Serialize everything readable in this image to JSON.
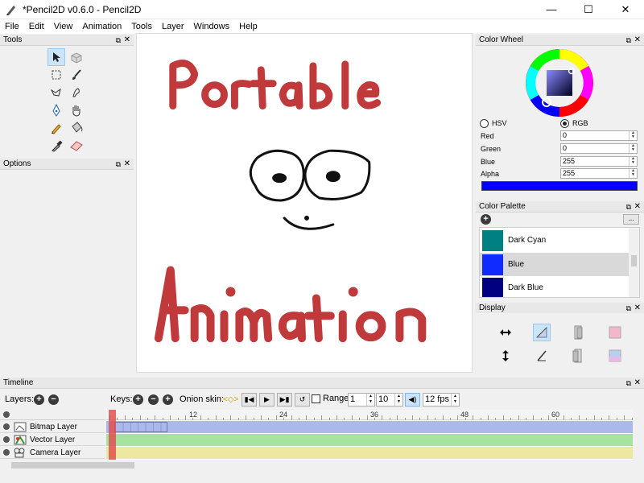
{
  "window": {
    "title": "*Pencil2D v0.6.0 - Pencil2D",
    "minimize": "—",
    "maximize": "☐",
    "close": "✕"
  },
  "menu": [
    "File",
    "Edit",
    "View",
    "Animation",
    "Tools",
    "Layer",
    "Windows",
    "Help"
  ],
  "panels": {
    "tools": "Tools",
    "options": "Options",
    "color_wheel": "Color Wheel",
    "color_palette": "Color Palette",
    "display": "Display",
    "timeline": "Timeline"
  },
  "tools": [
    {
      "name": "select",
      "icon": "pointer-icon",
      "selected": true
    },
    {
      "name": "smudge-bucket",
      "icon": "cube-icon"
    },
    {
      "name": "rect-select",
      "icon": "rect-select-icon"
    },
    {
      "name": "brush",
      "icon": "brush-icon"
    },
    {
      "name": "lasso",
      "icon": "lasso-icon"
    },
    {
      "name": "smudge",
      "icon": "smudge-icon"
    },
    {
      "name": "pen",
      "icon": "pen-nib-icon"
    },
    {
      "name": "hand",
      "icon": "hand-icon"
    },
    {
      "name": "pencil",
      "icon": "pencil-icon"
    },
    {
      "name": "bucket",
      "icon": "bucket-icon"
    },
    {
      "name": "eyedropper",
      "icon": "eyedropper-icon"
    },
    {
      "name": "eraser",
      "icon": "eraser-icon"
    }
  ],
  "canvas": {
    "drawing": "hand-drawn red lettering with a black cartoon face"
  },
  "color_wheel": {
    "mode_hsv": "HSV",
    "mode_rgb": "RGB",
    "selected_mode": "RGB",
    "fields": [
      {
        "label": "Red",
        "value": "0"
      },
      {
        "label": "Green",
        "value": "0"
      },
      {
        "label": "Blue",
        "value": "255"
      },
      {
        "label": "Alpha",
        "value": "255"
      }
    ],
    "current_color": "#0000ff"
  },
  "palette": {
    "more_label": "...",
    "items": [
      {
        "name": "Dark Cyan",
        "color": "#008080"
      },
      {
        "name": "Blue",
        "color": "#0000ff",
        "selected": true
      },
      {
        "name": "Dark Blue",
        "color": "#000080"
      }
    ]
  },
  "timeline": {
    "layers_label": "Layers:",
    "keys_label": "Keys:",
    "onion_label": "Onion skin:",
    "range_label": "Range",
    "range_start": "1",
    "range_end": "10",
    "fps": "12 fps",
    "ruler_labels": [
      "12",
      "24",
      "36",
      "48",
      "60"
    ],
    "layers": [
      {
        "name": "Bitmap Layer",
        "color": "#aab8ec"
      },
      {
        "name": "Vector Layer",
        "color": "#a4e4a0"
      },
      {
        "name": "Camera Layer",
        "color": "#ece8a0"
      }
    ]
  }
}
